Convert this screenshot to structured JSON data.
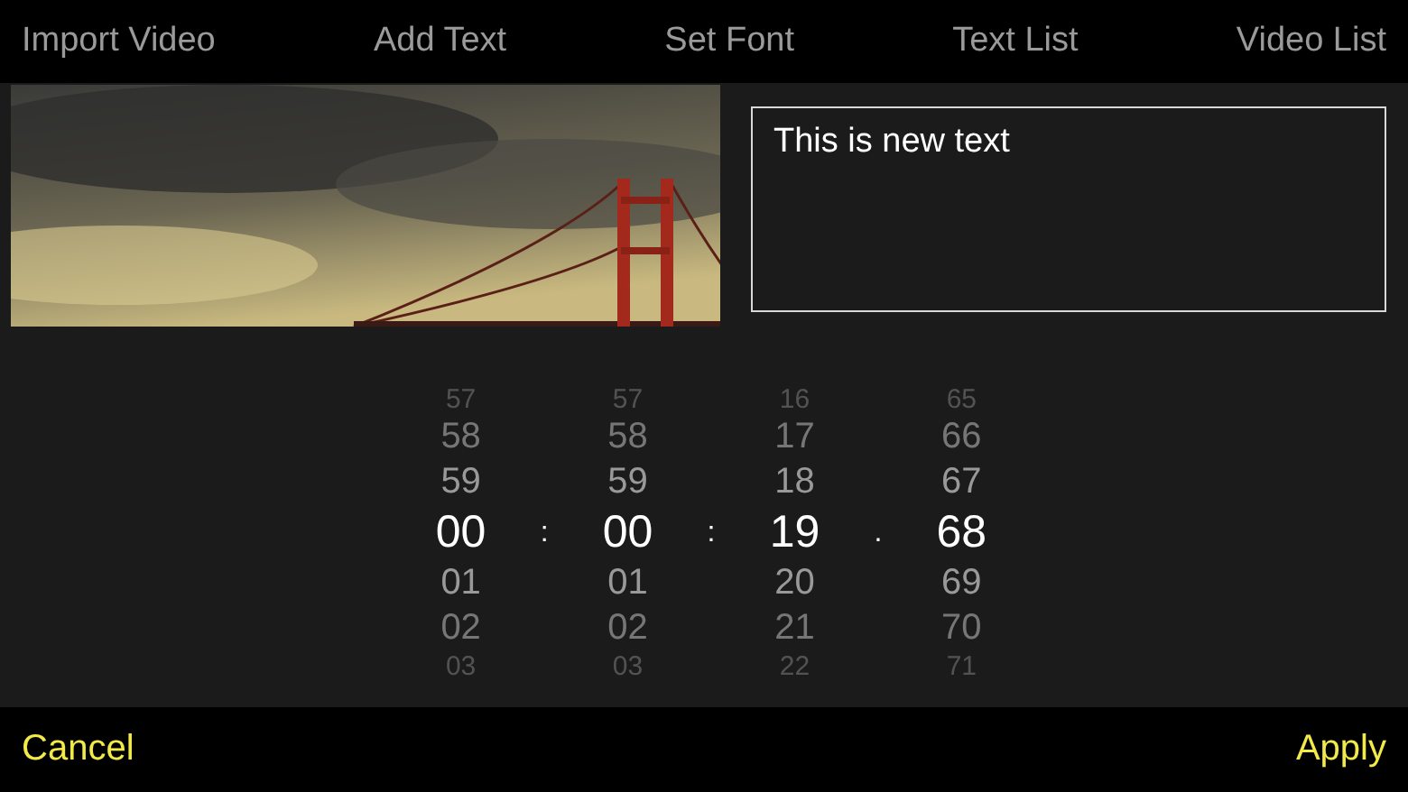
{
  "tabs": [
    {
      "label": "Import Video"
    },
    {
      "label": "Add Text"
    },
    {
      "label": "Set Font"
    },
    {
      "label": "Text List"
    },
    {
      "label": "Video List"
    }
  ],
  "text_field": {
    "value": "This is new text"
  },
  "time_picker": {
    "columns": [
      {
        "values": [
          {
            "text": "57",
            "selected": false
          },
          {
            "text": "58",
            "selected": false
          },
          {
            "text": "59",
            "selected": false
          },
          {
            "text": "00",
            "selected": true
          },
          {
            "text": "01",
            "selected": false
          },
          {
            "text": "02",
            "selected": false
          },
          {
            "text": "03",
            "selected": false
          }
        ],
        "separator": ":"
      },
      {
        "values": [
          {
            "text": "57",
            "selected": false
          },
          {
            "text": "58",
            "selected": false
          },
          {
            "text": "59",
            "selected": false
          },
          {
            "text": "00",
            "selected": true
          },
          {
            "text": "01",
            "selected": false
          },
          {
            "text": "02",
            "selected": false
          },
          {
            "text": "03",
            "selected": false
          }
        ],
        "separator": ":"
      },
      {
        "values": [
          {
            "text": "16",
            "selected": false
          },
          {
            "text": "17",
            "selected": false
          },
          {
            "text": "18",
            "selected": false
          },
          {
            "text": "19",
            "selected": true
          },
          {
            "text": "20",
            "selected": false
          },
          {
            "text": "21",
            "selected": false
          },
          {
            "text": "22",
            "selected": false
          }
        ],
        "separator": "."
      },
      {
        "values": [
          {
            "text": "65",
            "selected": false
          },
          {
            "text": "66",
            "selected": false
          },
          {
            "text": "67",
            "selected": false
          },
          {
            "text": "68",
            "selected": true
          },
          {
            "text": "69",
            "selected": false
          },
          {
            "text": "70",
            "selected": false
          },
          {
            "text": "71",
            "selected": false
          }
        ]
      }
    ]
  },
  "buttons": [
    {
      "label": "Cancel"
    },
    {
      "label": "Apply"
    }
  ]
}
